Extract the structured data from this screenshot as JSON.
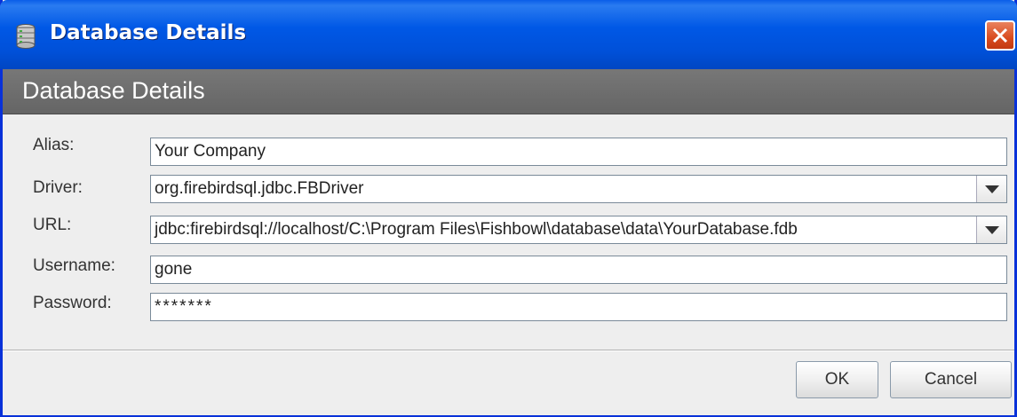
{
  "window": {
    "title": "Database Details",
    "icon": "database-icon",
    "close_icon": "close-icon"
  },
  "header": {
    "title": "Database Details"
  },
  "form": {
    "alias": {
      "label": "Alias:",
      "value": "Your Company"
    },
    "driver": {
      "label": "Driver:",
      "value": "org.firebirdsql.jdbc.FBDriver"
    },
    "url": {
      "label": "URL:",
      "value": "jdbc:firebirdsql://localhost/C:\\Program Files\\Fishbowl\\database\\data\\YourDatabase.fdb"
    },
    "username": {
      "label": "Username:",
      "value": "gone"
    },
    "password": {
      "label": "Password:",
      "value": "*******"
    }
  },
  "buttons": {
    "ok": "OK",
    "cancel": "Cancel"
  },
  "colors": {
    "titlebar": "#0054e3",
    "header": "#6e6e6e",
    "close": "#d94b1f"
  }
}
